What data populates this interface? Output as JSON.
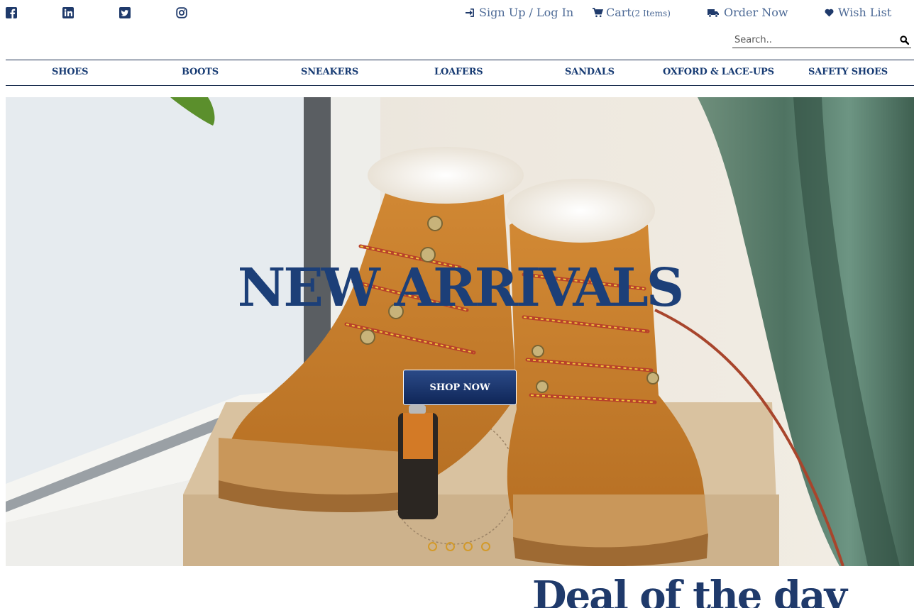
{
  "social": [
    {
      "name": "facebook-icon",
      "label": "Facebook"
    },
    {
      "name": "linkedin-icon",
      "label": "LinkedIn"
    },
    {
      "name": "twitter-icon",
      "label": "Twitter"
    },
    {
      "name": "instagram-icon",
      "label": "Instagram"
    }
  ],
  "account": {
    "signup_label": "Sign Up / Log In",
    "cart_label": "Cart",
    "cart_count": "(2 Items)",
    "order_label": "Order Now",
    "wishlist_label": "Wish List"
  },
  "search": {
    "placeholder": "Search..",
    "value": ""
  },
  "nav": {
    "items": [
      {
        "label": "SHOES"
      },
      {
        "label": "BOOTS"
      },
      {
        "label": "SNEAKERS"
      },
      {
        "label": "LOAFERS"
      },
      {
        "label": "SANDALS"
      },
      {
        "label": "OXFORD & LACE-UPS"
      },
      {
        "label": "SAFETY SHOES"
      }
    ]
  },
  "hero": {
    "title": "NEW ARRIVALS",
    "button_label": "SHOP NOW",
    "slide_count": 4,
    "image_subject": "tan lace-up boots with fur lining on a cardboard box by a window"
  },
  "deal": {
    "title": "Deal of the day"
  },
  "colors": {
    "brand_navy": "#1c3f78",
    "link_blue": "#4d6a96",
    "dot_gold": "#d39a2a"
  }
}
